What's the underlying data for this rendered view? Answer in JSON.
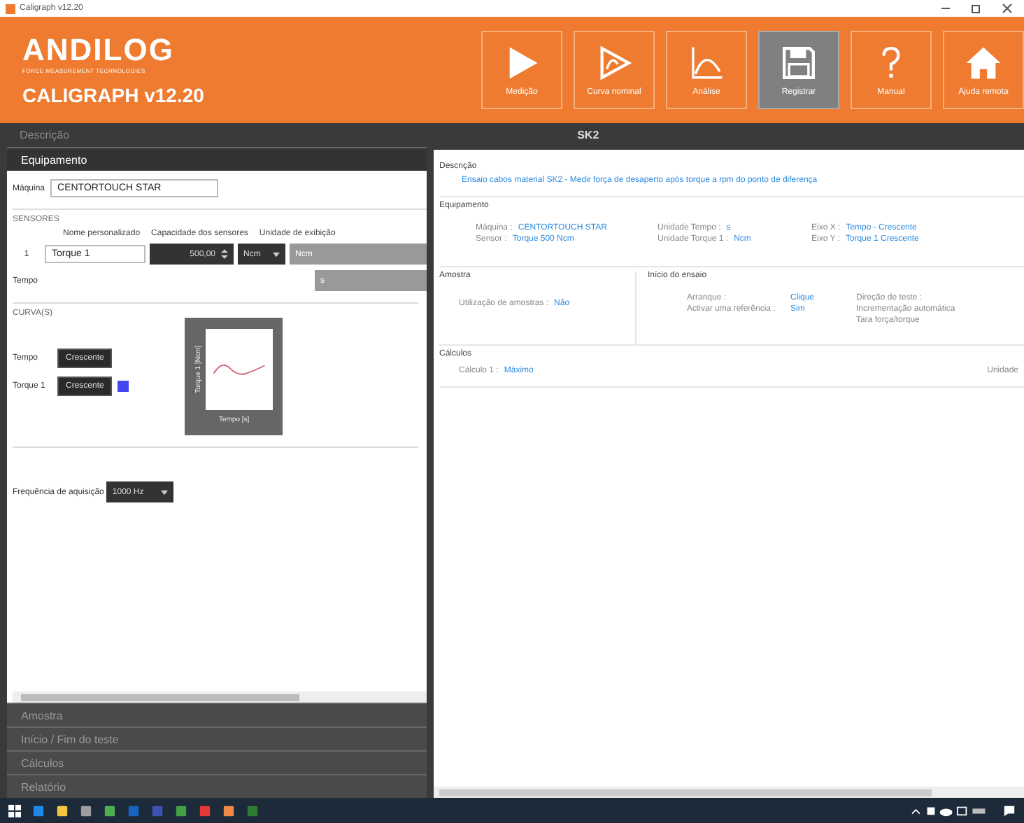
{
  "window": {
    "title": "Caligraph v12.20"
  },
  "header": {
    "logo": "ANDILOG",
    "tagline": "FORCE MEASUREMENT TECHNOLOGIES",
    "product": "CALIGRAPH v12.20",
    "buttons": [
      {
        "label": "Medição",
        "kind": "play",
        "selected": false
      },
      {
        "label": "Curva nominal",
        "kind": "curve",
        "selected": false
      },
      {
        "label": "Análise",
        "kind": "analysis",
        "selected": false
      },
      {
        "label": "Registrar",
        "kind": "save",
        "selected": true
      },
      {
        "label": "Manual",
        "kind": "help",
        "selected": false
      },
      {
        "label": "Ajuda remota",
        "kind": "home",
        "selected": false
      }
    ]
  },
  "bar": {
    "left": "Descrição",
    "right": "SK2"
  },
  "left": {
    "open_section": "Equipamento",
    "machine_label": "Máquina",
    "machine_value": "CENTORTOUCH STAR",
    "sensors": {
      "title": "SENSORES",
      "columns": [
        "Nome personalizado",
        "Capacidade dos sensores",
        "Unidade de exibição"
      ],
      "rows": [
        {
          "index": "1",
          "name": "Torque 1",
          "capacity": "500,00",
          "unit": "Ncm",
          "display_unit": "Ncm"
        }
      ],
      "time_label": "Tempo",
      "time_unit": "s"
    },
    "curves": {
      "title": "CURVA(S)",
      "items": [
        {
          "label": "Tempo",
          "order": "Crescente"
        },
        {
          "label": "Torque 1",
          "order": "Crescente",
          "color": "#4646ee"
        }
      ],
      "preview": {
        "ylabel": "Torque 1 [Ncm]",
        "xlabel": "Tempo [s]"
      }
    },
    "frequency": {
      "label": "Frequência de aquisição",
      "value": "1000 Hz"
    },
    "sections": [
      "Amostra",
      "Início / Fim do teste",
      "Cálculos",
      "Relatório"
    ]
  },
  "right": {
    "description": {
      "title": "Descrição",
      "text": "Ensaio cabos material SK2 - Medir força de desaperto após torque a rpm do ponto de diferença"
    },
    "equipment": {
      "title": "Equipamento",
      "columns": [
        [
          {
            "label": "Máquina :",
            "value": "CENTORTOUCH STAR"
          },
          {
            "label": "Sensor :",
            "value": "Torque 500 Ncm"
          }
        ],
        [
          {
            "label": "Unidade Tempo :",
            "value": "s"
          },
          {
            "label": "Unidade Torque 1 :",
            "value": "Ncm"
          }
        ],
        [
          {
            "label": "Eixo X :",
            "value": "Tempo - Crescente"
          },
          {
            "label": "Eixo Y :",
            "value": "Torque 1 Crescente"
          }
        ]
      ]
    },
    "sample": {
      "title": "Amostra",
      "items": [
        {
          "label": "Utilização de amostras :",
          "value": "Não"
        }
      ]
    },
    "start": {
      "title": "Início do ensaio",
      "items": [
        {
          "label": "Arranque :",
          "value": "Clique"
        },
        {
          "label": "Activar uma referência :",
          "value": "Sim"
        }
      ],
      "notes": [
        "Direção de teste :",
        "Incrementação automática",
        "Tara força/torque"
      ]
    },
    "calc": {
      "title": "Cálculos",
      "items": [
        {
          "label": "Cálculo 1 :",
          "value": "Máximo"
        }
      ],
      "side": "Unidade"
    }
  }
}
